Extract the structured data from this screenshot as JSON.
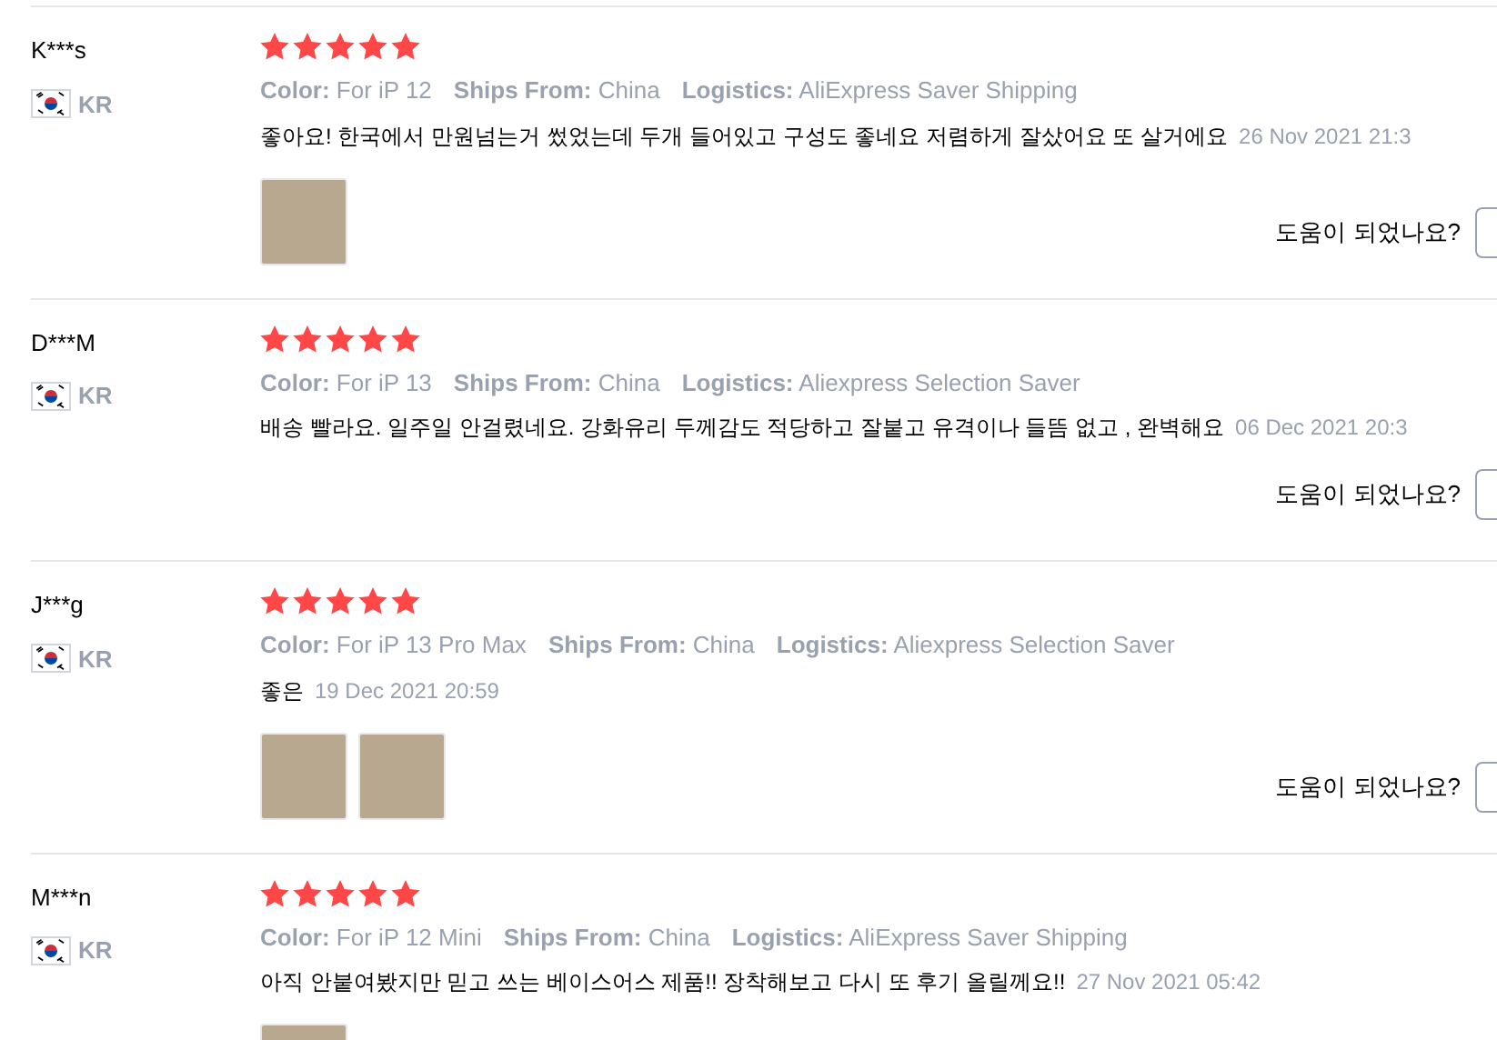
{
  "reviews": [
    {
      "user": "K***s",
      "country": "KR",
      "stars": 5,
      "variant_label": "Color:",
      "variant": "For iP 12",
      "ships_label": "Ships From:",
      "ships": "China",
      "logistics_label": "Logistics:",
      "logistics": "AliExpress Saver Shipping",
      "text": "좋아요! 한국에서 만원넘는거 썼었는데 두개 들어있고 구성도 좋네요 저렴하게 잘샀어요 또 살거에요",
      "date": "26 Nov 2021 21:3",
      "photos": [
        {
          "kind": "photo"
        }
      ],
      "helpful": "도움이 되었나요?"
    },
    {
      "user": "D***M",
      "country": "KR",
      "stars": 5,
      "variant_label": "Color:",
      "variant": "For iP 13",
      "ships_label": "Ships From:",
      "ships": "China",
      "logistics_label": "Logistics:",
      "logistics": "Aliexpress Selection Saver",
      "text": "배송 빨라요. 일주일 안걸렸네요. 강화유리 두께감도 적당하고 잘붙고 유격이나 들뜸 없고 , 완벽해요",
      "date": "06 Dec 2021 20:3",
      "helpful": "도움이 되었나요?"
    },
    {
      "user": "J***g",
      "country": "KR",
      "stars": 5,
      "variant_label": "Color:",
      "variant": "For iP 13 Pro Max",
      "ships_label": "Ships From:",
      "ships": "China",
      "logistics_label": "Logistics:",
      "logistics": "Aliexpress Selection Saver",
      "text": "좋은",
      "date": "19 Dec 2021 20:59",
      "photos": [
        {
          "kind": "photo"
        },
        {
          "kind": "photo"
        }
      ],
      "helpful": "도움이 되었나요?"
    },
    {
      "user": "M***n",
      "country": "KR",
      "stars": 5,
      "variant_label": "Color:",
      "variant": "For iP 12 Mini",
      "ships_label": "Ships From:",
      "ships": "China",
      "logistics_label": "Logistics:",
      "logistics": "AliExpress Saver Shipping",
      "text": "아직 안붙여봤지만 믿고 쓰는 베이스어스 제품!! 장착해보고 다시 또 후기 올릴께요!!",
      "date": "27 Nov 2021 05:42",
      "photos": [
        {
          "kind": "photo"
        }
      ]
    }
  ]
}
